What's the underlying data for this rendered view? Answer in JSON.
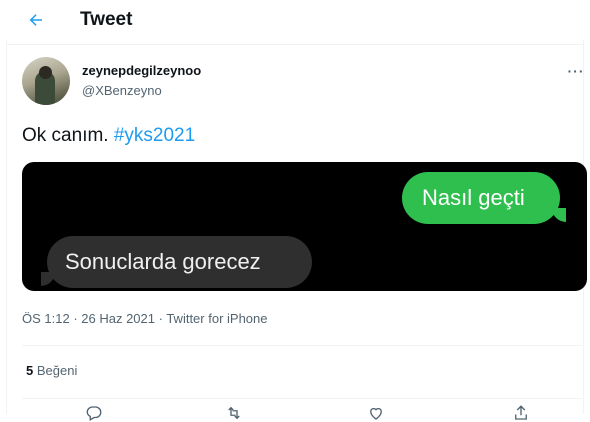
{
  "header": {
    "title": "Tweet",
    "back_icon": "arrow-left-icon"
  },
  "tweet": {
    "display_name": "zeynepdegilzeynoo",
    "handle": "@XBenzeyno",
    "text": "Ok canım.",
    "hashtag": "#yks2021",
    "more_icon": "more-horizontal-icon",
    "more_label": "···"
  },
  "media": {
    "sent_message": "Nasıl geçti",
    "received_message": "Sonuclarda gorecez"
  },
  "meta": {
    "time": "ÖS 1:12",
    "separator": " · ",
    "date": "26 Haz 2021",
    "source": "Twitter for iPhone"
  },
  "stats": {
    "likes_count": "5",
    "likes_label": "Beğeni"
  },
  "actions": [
    "reply-icon",
    "retweet-icon",
    "like-icon",
    "share-icon"
  ],
  "colors": {
    "accent": "#1d9bf0",
    "bubble_sent": "#2fbf4f",
    "bubble_received": "#2f2f2f",
    "muted": "#536471"
  }
}
